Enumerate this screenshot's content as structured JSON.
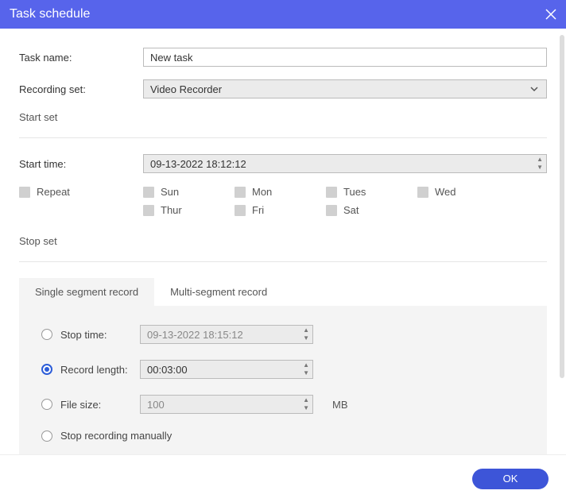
{
  "titlebar": {
    "title": "Task schedule"
  },
  "form": {
    "task_name_label": "Task name:",
    "task_name_value": "New task",
    "recording_set_label": "Recording set:",
    "recording_set_value": "Video Recorder"
  },
  "start": {
    "section": "Start set",
    "start_time_label": "Start time:",
    "start_time_value": "09-13-2022 18:12:12",
    "repeat_label": "Repeat",
    "days": {
      "sun": "Sun",
      "mon": "Mon",
      "tues": "Tues",
      "wed": "Wed",
      "thur": "Thur",
      "fri": "Fri",
      "sat": "Sat"
    }
  },
  "stop": {
    "section": "Stop set",
    "tabs": {
      "single": "Single segment record",
      "multi": "Multi-segment record"
    },
    "stop_time_label": "Stop time:",
    "stop_time_value": "09-13-2022 18:15:12",
    "record_length_label": "Record length:",
    "record_length_value": "00:03:00",
    "file_size_label": "File size:",
    "file_size_value": "100",
    "file_size_unit": "MB",
    "manual_label": "Stop recording manually"
  },
  "footer": {
    "ok": "OK"
  }
}
